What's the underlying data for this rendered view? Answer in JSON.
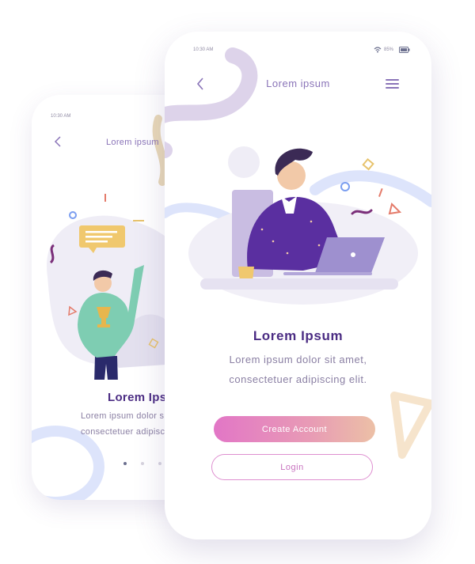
{
  "back_screen": {
    "status_time": "10:30 AM",
    "header_title": "Lorem ipsum",
    "heading": "Lorem Ipsum",
    "body_line1": "Lorem ipsum dolor sit amet,",
    "body_line2": "consectetuer adipiscing elit.",
    "page_dots": 3,
    "active_dot": 0
  },
  "front_screen": {
    "status_time": "10:30 AM",
    "battery_text": "85%",
    "header_title": "Lorem ipsum",
    "heading": "Lorem Ipsum",
    "body_line1": "Lorem ipsum dolor sit amet,",
    "body_line2": "consectetuer adipiscing elit.",
    "create_account_label": "Create Account",
    "login_label": "Login"
  },
  "icons": {
    "back": "chevron-left-icon",
    "menu": "hamburger-menu-icon",
    "wifi": "wifi-icon",
    "battery": "battery-icon"
  },
  "colors": {
    "accent_purple": "#4b2c83",
    "header_text": "#8a74b8",
    "body_text": "#8a7fa3",
    "button_gradient_start": "#e276c6",
    "button_gradient_end": "#ecc0a6",
    "login_border": "#de8fd0"
  }
}
